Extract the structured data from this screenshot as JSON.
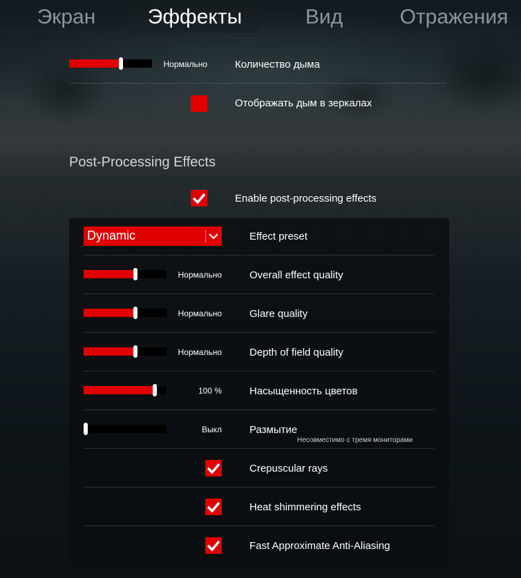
{
  "tabs": [
    {
      "label": "Экран",
      "active": false
    },
    {
      "label": "Эффекты",
      "active": true
    },
    {
      "label": "Вид",
      "active": false
    },
    {
      "label": "Отражения",
      "active": false
    }
  ],
  "smoke": {
    "amount": {
      "label": "Количество дыма",
      "value_text": "Нормально",
      "level": 0.625
    },
    "mirrors": {
      "label": "Отображать дым в зеркалах",
      "checked": false
    }
  },
  "post_processing": {
    "section_title": "Post-Processing Effects",
    "enable": {
      "label": "Enable post-processing effects",
      "checked": true
    },
    "preset": {
      "label": "Effect preset",
      "value": "Dynamic",
      "icon": "chevron-down-icon"
    },
    "sliders": [
      {
        "label": "Overall effect quality",
        "value_text": "Нормально",
        "level": 0.625
      },
      {
        "label": "Glare quality",
        "value_text": "Нормально",
        "level": 0.625
      },
      {
        "label": "Depth of field quality",
        "value_text": "Нормально",
        "level": 0.625
      },
      {
        "label": "Насыщенность цветов",
        "value_text": "100 %",
        "level": 0.86
      },
      {
        "label": "Размытие",
        "value_text": "Выкл",
        "level": 0.0,
        "note": "Несовместимо с тремя мониторами"
      }
    ],
    "toggles": [
      {
        "label": "Crepuscular rays",
        "checked": true
      },
      {
        "label": "Heat shimmering effects",
        "checked": true
      },
      {
        "label": "Fast Approximate Anti-Aliasing",
        "checked": true
      }
    ]
  },
  "colors": {
    "accent": "#e00000",
    "slider_track": "#000000",
    "thumb": "#ffffff"
  }
}
